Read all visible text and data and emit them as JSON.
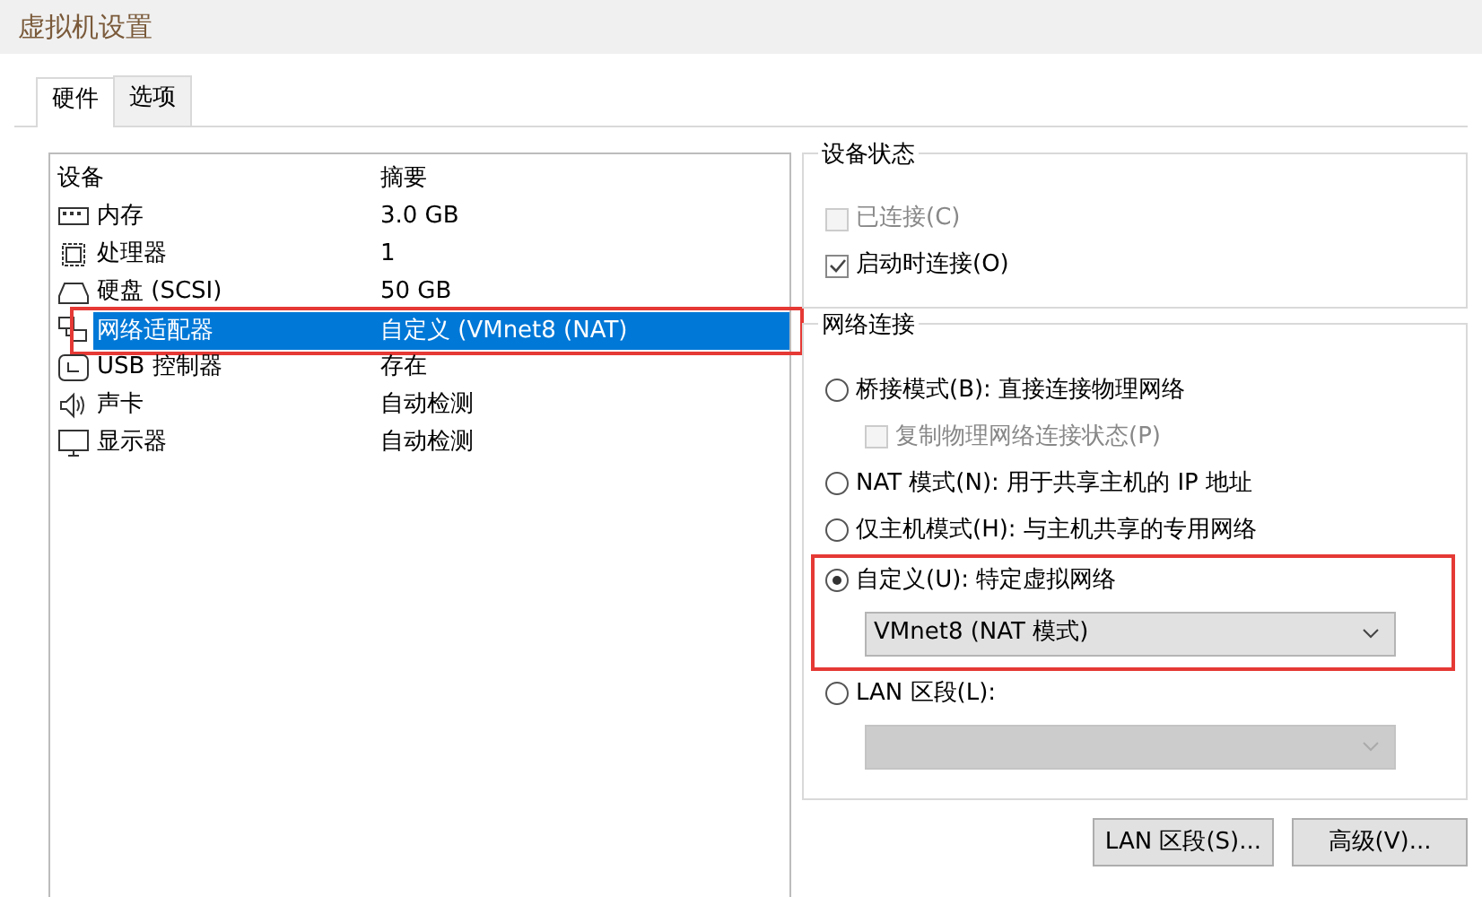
{
  "window": {
    "title": "虚拟机设置"
  },
  "tabs": [
    {
      "label": "硬件",
      "selected": true
    },
    {
      "label": "选项",
      "selected": false
    }
  ],
  "devices": {
    "columns": [
      "设备",
      "摘要"
    ],
    "rows": [
      {
        "kind": "memory",
        "name": "内存",
        "summary": "3.0 GB",
        "selected": false
      },
      {
        "kind": "cpu",
        "name": "处理器",
        "summary": "1",
        "selected": false
      },
      {
        "kind": "disk",
        "name": "硬盘 (SCSI)",
        "summary": "50 GB",
        "selected": false
      },
      {
        "kind": "network",
        "name": "网络适配器",
        "summary": "自定义 (VMnet8 (NAT)",
        "selected": true,
        "annotated": true
      },
      {
        "kind": "usb",
        "name": "USB 控制器",
        "summary": "存在",
        "selected": false
      },
      {
        "kind": "sound",
        "name": "声卡",
        "summary": "自动检测",
        "selected": false
      },
      {
        "kind": "display",
        "name": "显示器",
        "summary": "自动检测",
        "selected": false
      }
    ]
  },
  "device_status": {
    "title": "设备状态",
    "options": [
      {
        "label": "已连接(C)",
        "checked": false,
        "disabled": true
      },
      {
        "label": "启动时连接(O)",
        "checked": true,
        "disabled": false
      }
    ]
  },
  "network_connection": {
    "title": "网络连接",
    "options": [
      {
        "kind": "radio",
        "label": "桥接模式(B): 直接连接物理网络",
        "selected": false
      },
      {
        "kind": "checkbox",
        "label": "复制物理网络连接状态(P)",
        "checked": false,
        "disabled": true
      },
      {
        "kind": "radio",
        "label": "NAT 模式(N): 用于共享主机的 IP 地址",
        "selected": false
      },
      {
        "kind": "radio",
        "label": "仅主机模式(H): 与主机共享的专用网络",
        "selected": false
      },
      {
        "kind": "radio",
        "label": "自定义(U): 特定虚拟网络",
        "selected": true,
        "annotated": true
      },
      {
        "kind": "select",
        "value": "VMnet8 (NAT 模式)",
        "disabled": false,
        "annotated": true
      },
      {
        "kind": "radio",
        "label": "LAN 区段(L):",
        "selected": false
      },
      {
        "kind": "select",
        "disabled": true
      }
    ]
  },
  "buttons": [
    "LAN 区段(S)...",
    "高级(V)..."
  ]
}
